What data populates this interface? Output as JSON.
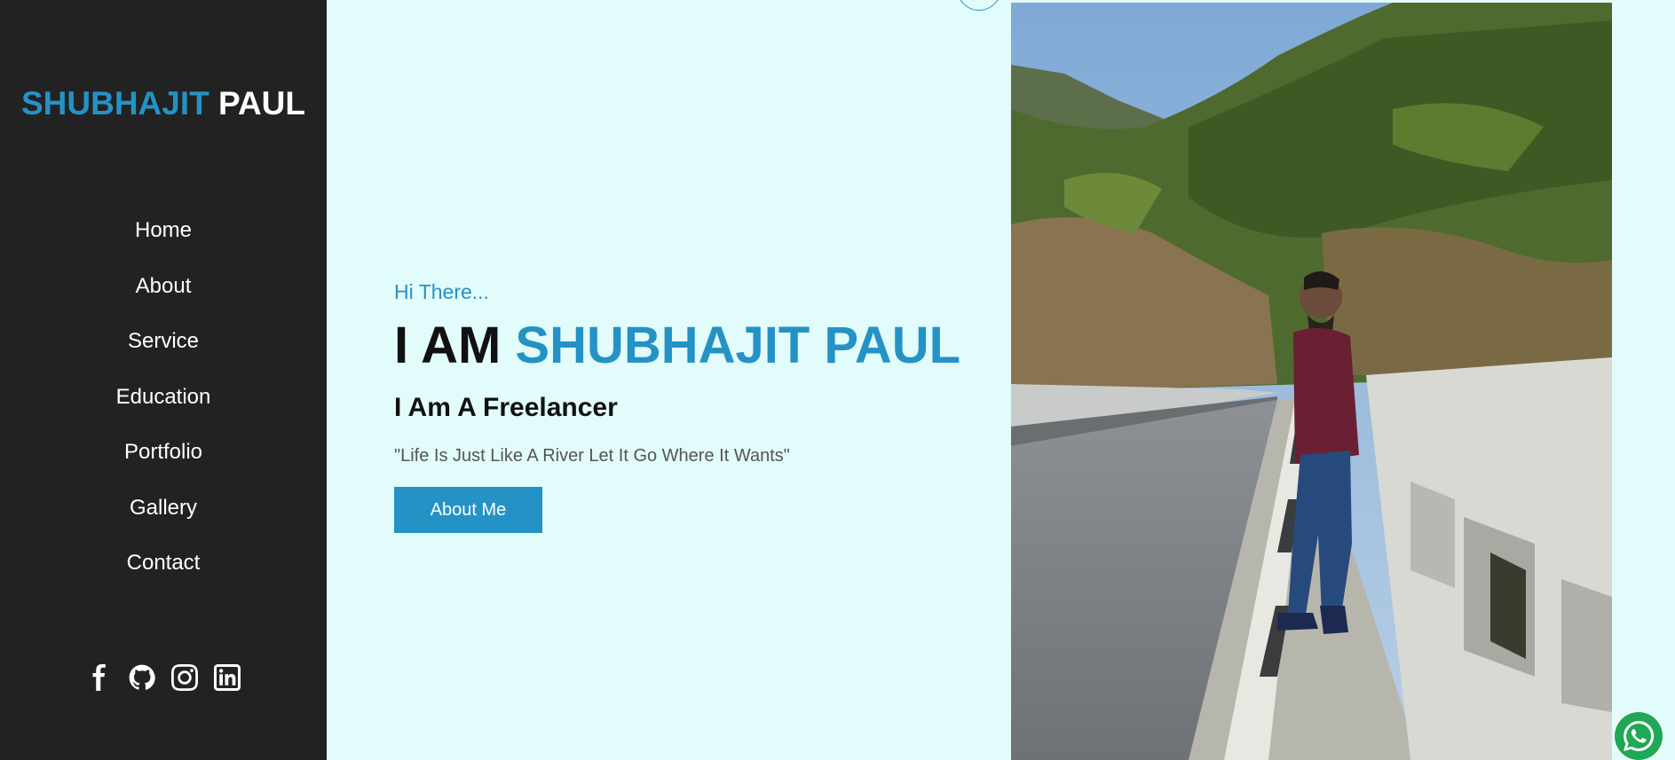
{
  "sidebar": {
    "logo_first": "SHUBHAJIT",
    "logo_last": "PAUL",
    "nav": [
      {
        "label": "Home"
      },
      {
        "label": "About"
      },
      {
        "label": "Service"
      },
      {
        "label": "Education"
      },
      {
        "label": "Portfolio"
      },
      {
        "label": "Gallery"
      },
      {
        "label": "Contact"
      }
    ],
    "social_icons": [
      "facebook-icon",
      "github-icon",
      "instagram-icon",
      "linkedin-icon"
    ]
  },
  "hero": {
    "greeting": "Hi There...",
    "headline_prefix": "I AM",
    "headline_name": "SHUBHAJIT PAUL",
    "role": "I Am A Freelancer",
    "quote": "\"Life Is Just Like A River Let It Go Where It Wants\"",
    "button_label": "About Me"
  },
  "photo": {
    "subject": "portrait photo on bridge"
  },
  "floating": {
    "whatsapp_icon": "whatsapp-icon"
  },
  "colors": {
    "accent": "#2592c6",
    "sidebar_bg": "#222222",
    "page_bg": "#e2fbfb",
    "whatsapp": "#1fa855"
  }
}
